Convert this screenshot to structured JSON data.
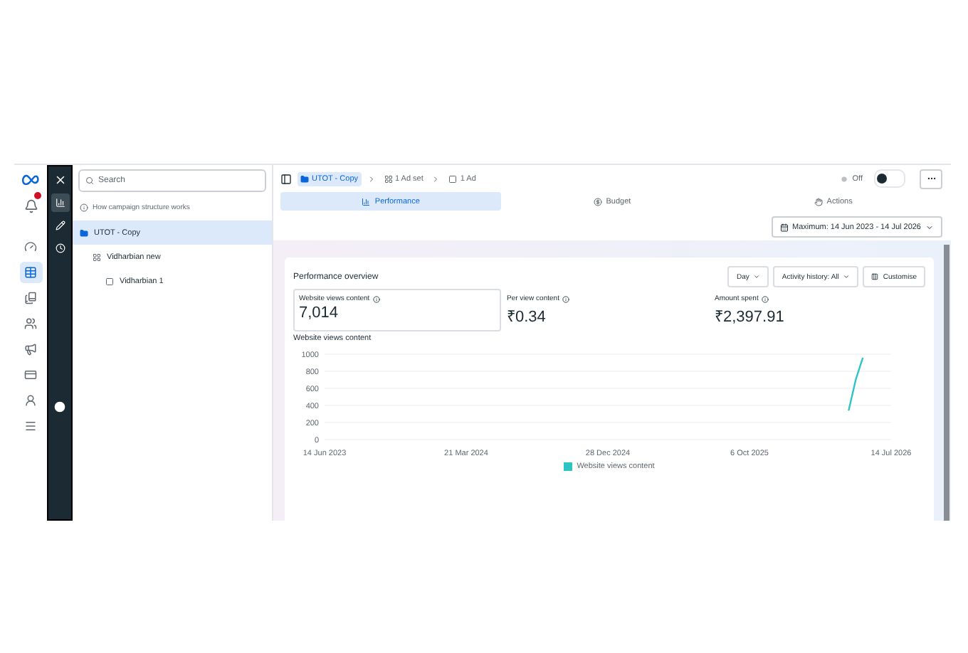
{
  "nav_rail": {
    "items": [
      {
        "kind": "gauge",
        "selected": false
      },
      {
        "kind": "table",
        "selected": true
      },
      {
        "kind": "book",
        "selected": false
      },
      {
        "kind": "users",
        "selected": false
      },
      {
        "kind": "megaphone",
        "selected": false
      },
      {
        "kind": "card",
        "selected": false
      },
      {
        "kind": "person",
        "selected": false
      },
      {
        "kind": "menu",
        "selected": false
      }
    ]
  },
  "tool_rail": {
    "items": [
      {
        "kind": "chart",
        "selected": true
      },
      {
        "kind": "pencil",
        "selected": false
      },
      {
        "kind": "clock",
        "selected": false
      }
    ]
  },
  "tree": {
    "search": {
      "placeholder": "Search"
    },
    "help": "How campaign structure works",
    "items": [
      {
        "kind": "campaign",
        "label": "UTOT - Copy",
        "selected": true,
        "children": [
          {
            "kind": "adset",
            "label": "Vidharbian new",
            "selected": false,
            "children": [
              {
                "kind": "ad",
                "label": "Vidharbian 1",
                "selected": false
              }
            ]
          }
        ]
      }
    ]
  },
  "breadcrumb": [
    {
      "kind": "campaign",
      "label": "UTOT - Copy",
      "selected": true
    },
    {
      "kind": "adset",
      "label": "1 Ad set",
      "selected": false
    },
    {
      "kind": "ad",
      "label": "1 Ad",
      "selected": false
    }
  ],
  "toggle": {
    "label": "Off",
    "on": false
  },
  "tabs": [
    {
      "kind": "chart",
      "label": "Performance",
      "selected": true
    },
    {
      "kind": "dollar",
      "label": "Budget",
      "selected": false
    },
    {
      "kind": "actions",
      "label": "Actions",
      "selected": false
    }
  ],
  "date_range": "Maximum: 14 Jun 2023 - 14 Jul 2026",
  "overview": {
    "title": "Performance overview",
    "controls": [
      "Day",
      "Activity history: All"
    ],
    "customise": "Customise",
    "metrics": [
      {
        "label": "Website views content",
        "value": "7,014",
        "selected": true
      },
      {
        "label": "Per view content",
        "value": "₹0.34",
        "selected": false
      },
      {
        "label": "Amount spent",
        "value": "₹2,397.91",
        "selected": false
      }
    ],
    "chart_title": "Website views content",
    "chart_data": {
      "type": "line",
      "grid": true,
      "ylim": [
        0,
        1000
      ],
      "yticks": [
        0,
        200,
        400,
        600,
        800,
        1000
      ],
      "categories": [
        "14 Jun 2023",
        null,
        null,
        null,
        null,
        null,
        null,
        null,
        null,
        null,
        null,
        null,
        null,
        null,
        null,
        null,
        null,
        null,
        null,
        null,
        "21 Mar 2024",
        null,
        null,
        null,
        null,
        null,
        null,
        null,
        null,
        null,
        null,
        null,
        null,
        null,
        null,
        null,
        null,
        null,
        null,
        null,
        "28 Dec 2024",
        null,
        null,
        null,
        null,
        null,
        null,
        null,
        null,
        null,
        null,
        null,
        null,
        null,
        null,
        null,
        null,
        null,
        null,
        null,
        "6 Oct 2025",
        null,
        null,
        null,
        null,
        null,
        null,
        null,
        null,
        null,
        null,
        null,
        null,
        null,
        null,
        null,
        null,
        null,
        null,
        null,
        "14 Jul 2026"
      ],
      "series": [
        {
          "name": "Website views content",
          "color": "#2ec4c4",
          "values": [
            null,
            null,
            null,
            null,
            null,
            null,
            null,
            null,
            null,
            null,
            null,
            null,
            null,
            null,
            null,
            null,
            null,
            null,
            null,
            null,
            null,
            null,
            null,
            null,
            null,
            null,
            null,
            null,
            null,
            null,
            null,
            null,
            null,
            null,
            null,
            null,
            null,
            null,
            null,
            null,
            null,
            null,
            null,
            null,
            null,
            null,
            null,
            null,
            null,
            null,
            null,
            null,
            null,
            null,
            null,
            null,
            null,
            null,
            null,
            null,
            null,
            null,
            null,
            null,
            null,
            null,
            null,
            null,
            null,
            null,
            null,
            null,
            null,
            null,
            340,
            700,
            960,
            null,
            null,
            null,
            null
          ]
        }
      ]
    }
  }
}
